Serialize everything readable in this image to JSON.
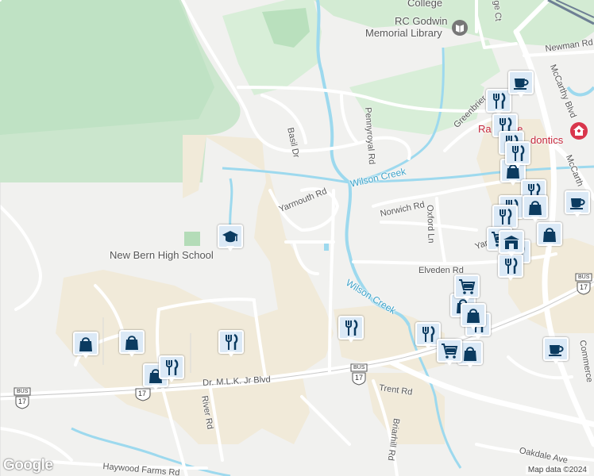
{
  "map": {
    "attribution": "Map data ©2024",
    "logo": "Google"
  },
  "places": {
    "college": "College",
    "library_line1": "RC Godwin",
    "library_line2": "Memorial Library",
    "high_school": "New Bern High School",
    "orthodontics": "Ra        Fiume",
    "orthodontics_line2": "dontics"
  },
  "streets": {
    "basil": "Basil Dr",
    "pennyroyal": "Pennyroyal Rd",
    "yarmouth": "Yarmouth Rd",
    "norwich": "Norwich Rd",
    "oxford": "Oxford Ln",
    "elveden": "Elveden Rd",
    "mlk": "Dr. M.L.K. Jr Blvd",
    "trent": "Trent Rd",
    "river": "River Rd",
    "briarhill": "Briarhill Rd",
    "haywood": "Haywood Farms Rd",
    "oakdale": "Oakdale Ave",
    "commerce": "Commerce",
    "mccarthy": "McCarthy Blvd",
    "mccarthy2": "McCarth",
    "newman": "Newman Rd",
    "greenbrier": "Greenbrier",
    "yarmouth2": "Yar",
    "college_ct": "ge Ct"
  },
  "water": {
    "wilson_creek": "Wilson Creek"
  },
  "shields": {
    "bus_label": "BUS",
    "route": "17"
  },
  "pins": [
    {
      "icon": "shopping-bag-icon"
    },
    {
      "icon": "shopping-bag-icon"
    },
    {
      "icon": "shopping-bag-icon"
    },
    {
      "icon": "restaurant-icon"
    },
    {
      "icon": "restaurant-icon"
    },
    {
      "icon": "restaurant-icon"
    },
    {
      "icon": "school-icon"
    },
    {
      "icon": "cafe-icon"
    },
    {
      "icon": "cafe-icon"
    },
    {
      "icon": "cafe-icon"
    },
    {
      "icon": "shopping-cart-icon"
    },
    {
      "icon": "shopping-cart-icon"
    },
    {
      "icon": "shopping-cart-icon"
    },
    {
      "icon": "supermarket-icon"
    },
    {
      "icon": "library-icon"
    },
    {
      "icon": "dental-icon"
    }
  ],
  "colors": {
    "park_green": "#cde8cf",
    "dark_green": "#b4dcb8",
    "urban_tan": "#f1ead9",
    "road": "#ffffff",
    "water": "#8fd3ec",
    "pin_bg": "#dbe9f6",
    "pin_icon": "#0b3b60"
  }
}
